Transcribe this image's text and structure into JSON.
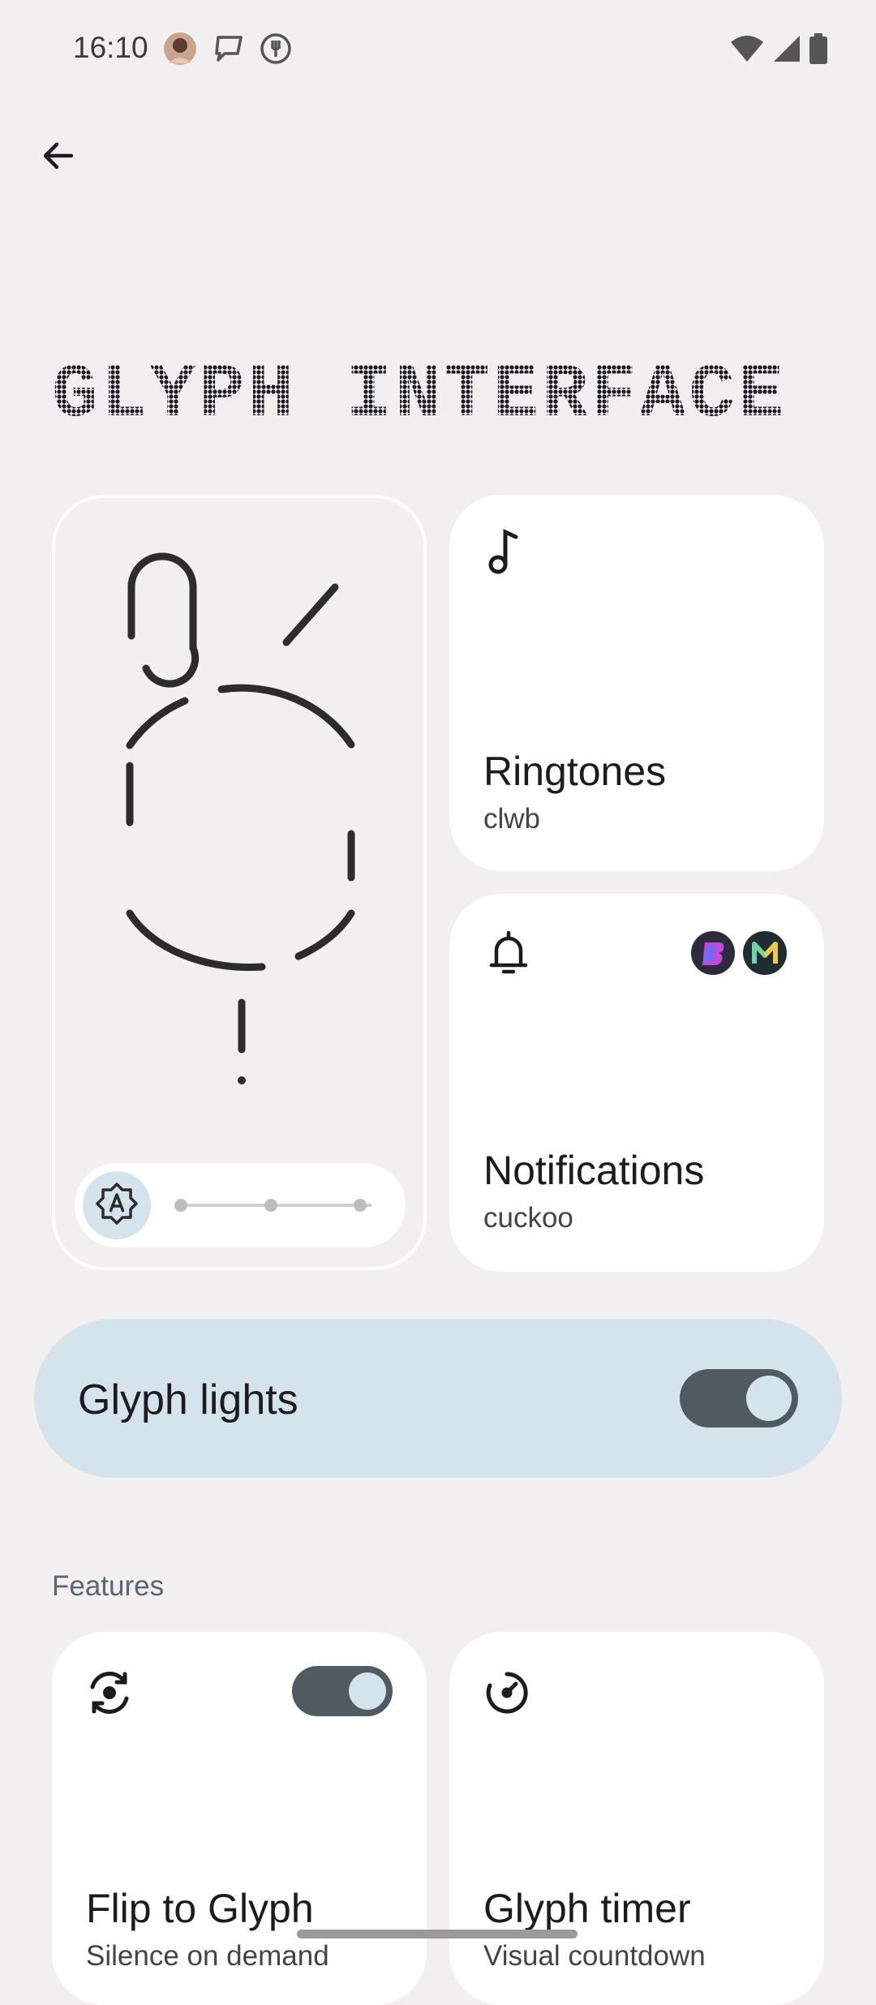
{
  "status_bar": {
    "time": "16:10",
    "left_icons": [
      "avatar-notification-icon",
      "chat-bubble-icon",
      "fork-knife-icon"
    ],
    "right_icons": [
      "wifi-icon",
      "cell-signal-icon",
      "battery-icon"
    ]
  },
  "header": {
    "back_icon": "arrow-left-icon",
    "title": "GLYPH INTERFACE"
  },
  "glyph_preview": {
    "brightness_icon": "brightness-auto-icon",
    "brightness_steps": 3
  },
  "ringtones": {
    "icon": "music-note-icon",
    "title": "Ringtones",
    "subtitle": "clwb"
  },
  "notifications": {
    "icon": "bell-icon",
    "title": "Notifications",
    "subtitle": "cuckoo",
    "app_icons": [
      "beeper-app-icon",
      "m-app-icon"
    ]
  },
  "glyph_lights": {
    "label": "Glyph lights",
    "enabled": true
  },
  "features": {
    "section_label": "Features",
    "items": [
      {
        "title": "Flip to Glyph",
        "subtitle": "Silence on demand",
        "icon": "flip-icon",
        "enabled": true
      },
      {
        "title": "Glyph timer",
        "subtitle": "Visual countdown",
        "icon": "timer-icon"
      }
    ]
  },
  "colors": {
    "background": "#f1eff0",
    "accent_surface": "#d5e3ed",
    "toggle_track": "#4f5a62"
  }
}
